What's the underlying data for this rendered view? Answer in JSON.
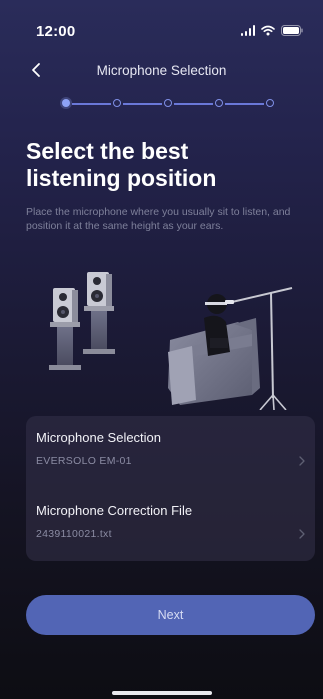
{
  "status_bar": {
    "time": "12:00",
    "icons": [
      "signal-icon",
      "wifi-icon",
      "battery-icon"
    ]
  },
  "nav": {
    "back_icon": "chevron-left-icon",
    "title": "Microphone Selection"
  },
  "stepper": {
    "total_steps": 5,
    "current_step": 1
  },
  "content": {
    "heading_line1": "Select the best",
    "heading_line2": "listening position",
    "description": "Place the microphone where you usually sit to listen, and position it at the same height as your ears."
  },
  "settings": {
    "microphone": {
      "label": "Microphone Selection",
      "value": "EVERSOLO EM-01"
    },
    "correction_file": {
      "label": "Microphone Correction File",
      "value": "2439110021.txt"
    }
  },
  "actions": {
    "next_label": "Next"
  },
  "colors": {
    "accent": "#5265b5",
    "stepper": "#8ea2f5",
    "background_top": "#2a2c5a",
    "background_bottom": "#0d0d13",
    "card": "#34324a"
  }
}
